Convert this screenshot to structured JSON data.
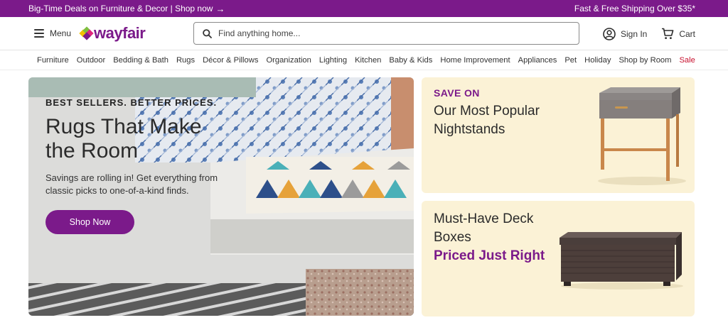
{
  "promo": {
    "left_text": "Big-Time Deals on Furniture & Decor | Shop now",
    "arrow": "→",
    "right_text": "Fast & Free Shipping Over $35*"
  },
  "header": {
    "menu_label": "Menu",
    "logo_text": "wayfair",
    "search_placeholder": "Find anything home...",
    "search_value": "",
    "sign_in_label": "Sign In",
    "cart_label": "Cart"
  },
  "nav": {
    "items": [
      "Furniture",
      "Outdoor",
      "Bedding & Bath",
      "Rugs",
      "Décor & Pillows",
      "Organization",
      "Lighting",
      "Kitchen",
      "Baby & Kids",
      "Home Improvement",
      "Appliances",
      "Pet",
      "Holiday",
      "Shop by Room"
    ],
    "sale_label": "Sale"
  },
  "hero": {
    "eyebrow": "BEST SELLERS. BETTER PRICES.",
    "title": "Rugs That Make the Room",
    "subtitle": "Savings are rolling in! Get everything from classic picks to one-of-a-kind finds.",
    "button_label": "Shop Now"
  },
  "promo_cards": {
    "nightstands": {
      "eyebrow": "SAVE ON",
      "title": "Our Most Popular Nightstands"
    },
    "deck_boxes": {
      "title": "Must-Have Deck Boxes",
      "accent": "Priced Just Right"
    }
  },
  "colors": {
    "brand_purple": "#7b1a8a",
    "sale_red": "#c8102e",
    "card_cream": "#fbf2d6"
  },
  "icons": [
    "hamburger-icon",
    "wayfair-logo-mark-icon",
    "search-icon",
    "account-icon",
    "cart-icon",
    "arrow-right-icon"
  ]
}
